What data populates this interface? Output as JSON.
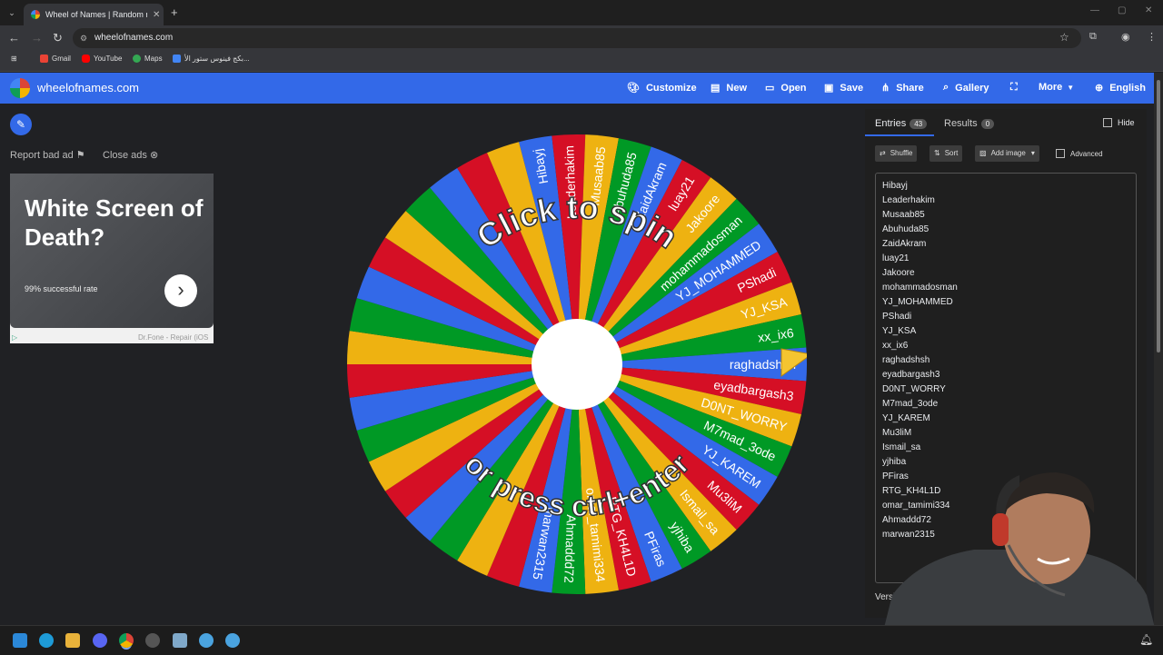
{
  "browser": {
    "tab_title": "Wheel of Names | Random name",
    "url": "wheelofnames.com",
    "bookmarks": [
      "Gmail",
      "YouTube",
      "Maps",
      "بكج فينوس ستور الأ..."
    ]
  },
  "header": {
    "brand": "wheelofnames.com",
    "menu": [
      "Customize",
      "New",
      "Open",
      "Save",
      "Share",
      "Gallery",
      "More",
      "English"
    ]
  },
  "left": {
    "report_ad": "Report bad ad",
    "close_ads": "Close ads",
    "ad_title": "White Screen of Death?",
    "ad_sub": "99% successful rate",
    "ad_footer": "Dr.Fone - Repair (iOS"
  },
  "wheel": {
    "top_text": "Click to spin",
    "bottom_text": "or press ctrl+enter",
    "colors": [
      "#3369e8",
      "#d50f25",
      "#eeb211",
      "#009925"
    ]
  },
  "panel": {
    "tab_entries": "Entries",
    "entries_count": "43",
    "tab_results": "Results",
    "results_count": "0",
    "hide": "Hide",
    "shuffle": "Shuffle",
    "sort": "Sort",
    "add_image": "Add image",
    "advanced": "Advanced",
    "version": "Version 3",
    "entries": [
      "Hibayj",
      "Leaderhakim",
      "Musaab85",
      "Abuhuda85",
      "ZaidAkram",
      "luay21",
      "Jakoore",
      "mohammadosman",
      "YJ_MOHAMMED",
      "PShadi",
      "YJ_KSA",
      "xx_ix6",
      "raghadshsh",
      "eyadbargash3",
      "D0NT_WORRY",
      "M7mad_3ode",
      "YJ_KAREM",
      "Mu3liM",
      "Ismail_sa",
      "yjhiba",
      "PFiras",
      "RTG_KH4L1D",
      "omar_tamimi334",
      "Ahmaddd72",
      "marwan2315"
    ]
  }
}
